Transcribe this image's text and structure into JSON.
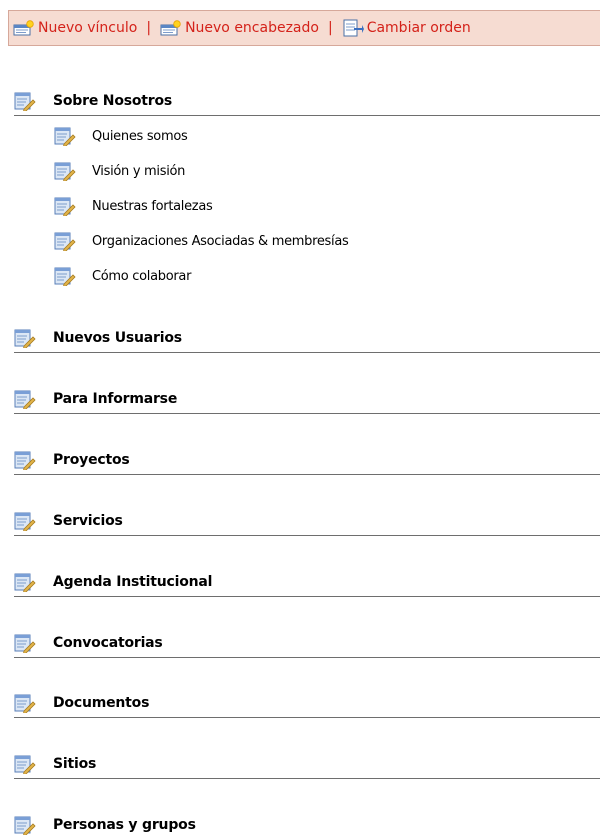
{
  "toolbar": {
    "new_link": "Nuevo vínculo",
    "separator": "|",
    "new_heading": "Nuevo encabezado",
    "change_order": "Cambiar orden"
  },
  "nav": {
    "sections": [
      {
        "label": "Sobre Nosotros",
        "links": [
          {
            "label": "Quienes somos"
          },
          {
            "label": "Visión y misión"
          },
          {
            "label": "Nuestras fortalezas"
          },
          {
            "label": "Organizaciones Asociadas & membresías"
          },
          {
            "label": "Cómo colaborar"
          }
        ]
      },
      {
        "label": "Nuevos Usuarios"
      },
      {
        "label": "Para Informarse"
      },
      {
        "label": "Proyectos"
      },
      {
        "label": "Servicios"
      },
      {
        "label": "Agenda Institucional"
      },
      {
        "label": "Convocatorias"
      },
      {
        "label": "Documentos"
      },
      {
        "label": "Sitios"
      },
      {
        "label": "Personas y grupos"
      }
    ]
  },
  "icons": {
    "toolbar_new_link": "new-link-icon",
    "toolbar_new_heading": "new-heading-icon",
    "toolbar_change_order": "change-order-icon",
    "nav_item": "page-edit-icon"
  },
  "colors": {
    "toolbar_background": "#f6dcd2",
    "toolbar_text": "#d4221a",
    "divider": "#6e6e6e"
  }
}
